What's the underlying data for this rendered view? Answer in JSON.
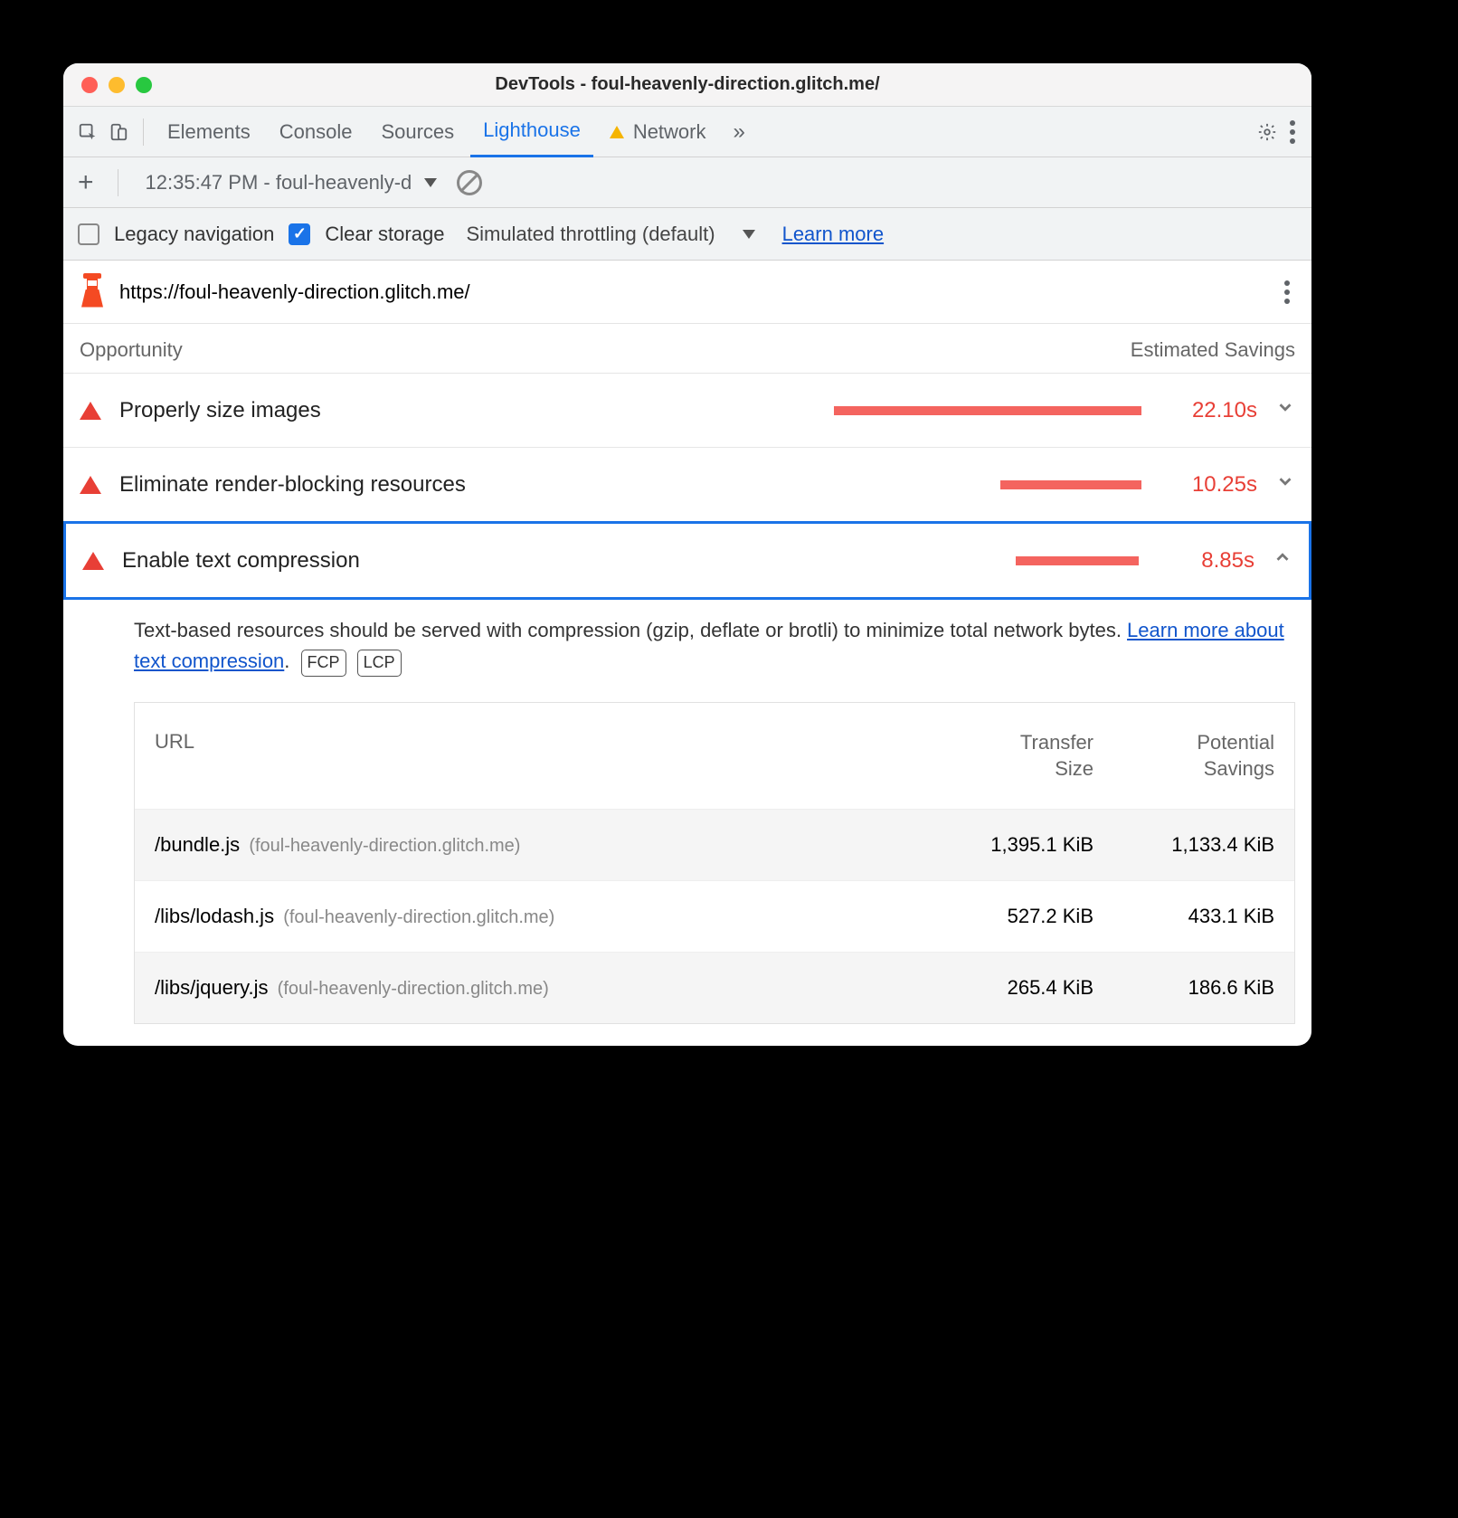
{
  "window": {
    "title": "DevTools - foul-heavenly-direction.glitch.me/"
  },
  "tabs": {
    "elements": "Elements",
    "console": "Console",
    "sources": "Sources",
    "lighthouse": "Lighthouse",
    "network": "Network"
  },
  "lh_toolbar": {
    "run_label": "12:35:47 PM - foul-heavenly-d",
    "legacy_nav": "Legacy navigation",
    "clear_storage": "Clear storage",
    "throttling": "Simulated throttling (default)",
    "learn_more": "Learn more"
  },
  "report": {
    "url": "https://foul-heavenly-direction.glitch.me/",
    "col_opp": "Opportunity",
    "col_sav": "Estimated Savings"
  },
  "opps": [
    {
      "label": "Properly size images",
      "savings": "22.10s",
      "bar_pct": 100
    },
    {
      "label": "Eliminate render-blocking resources",
      "savings": "10.25s",
      "bar_pct": 46
    },
    {
      "label": "Enable text compression",
      "savings": "8.85s",
      "bar_pct": 40
    }
  ],
  "expanded": {
    "desc1": "Text-based resources should be served with compression (gzip, deflate or brotli) to minimize total network bytes. ",
    "learn": "Learn more about text compression",
    "pill1": "FCP",
    "pill2": "LCP",
    "table": {
      "h_url": "URL",
      "h_ts1": "Transfer",
      "h_ts2": "Size",
      "h_ps1": "Potential",
      "h_ps2": "Savings",
      "rows": [
        {
          "path": "/bundle.js",
          "origin": "(foul-heavenly-direction.glitch.me)",
          "ts": "1,395.1 KiB",
          "ps": "1,133.4 KiB"
        },
        {
          "path": "/libs/lodash.js",
          "origin": "(foul-heavenly-direction.glitch.me)",
          "ts": "527.2 KiB",
          "ps": "433.1 KiB"
        },
        {
          "path": "/libs/jquery.js",
          "origin": "(foul-heavenly-direction.glitch.me)",
          "ts": "265.4 KiB",
          "ps": "186.6 KiB"
        }
      ]
    }
  }
}
